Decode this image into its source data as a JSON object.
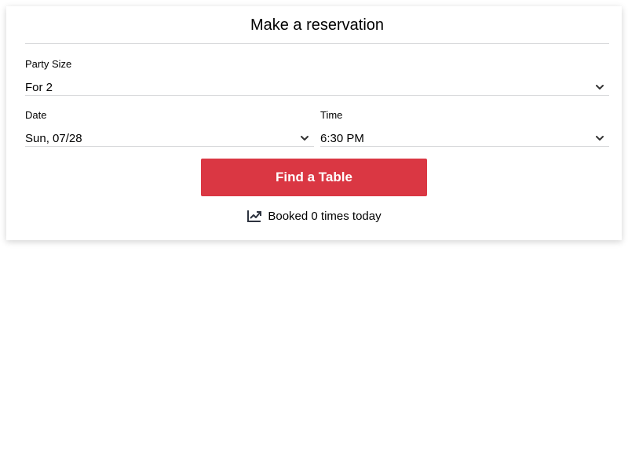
{
  "reservation": {
    "title": "Make a reservation",
    "party_size": {
      "label": "Party Size",
      "value": "For 2"
    },
    "date": {
      "label": "Date",
      "value": "Sun, 07/28"
    },
    "time": {
      "label": "Time",
      "value": "6:30 PM"
    },
    "find_button_label": "Find a Table",
    "booked_text": "Booked 0 times today",
    "icons": {
      "dropdown": "chevron-down-icon",
      "booked": "trending-up-icon"
    },
    "colors": {
      "accent": "#da3743",
      "divider": "#d8d9db",
      "text": "#000000"
    }
  }
}
